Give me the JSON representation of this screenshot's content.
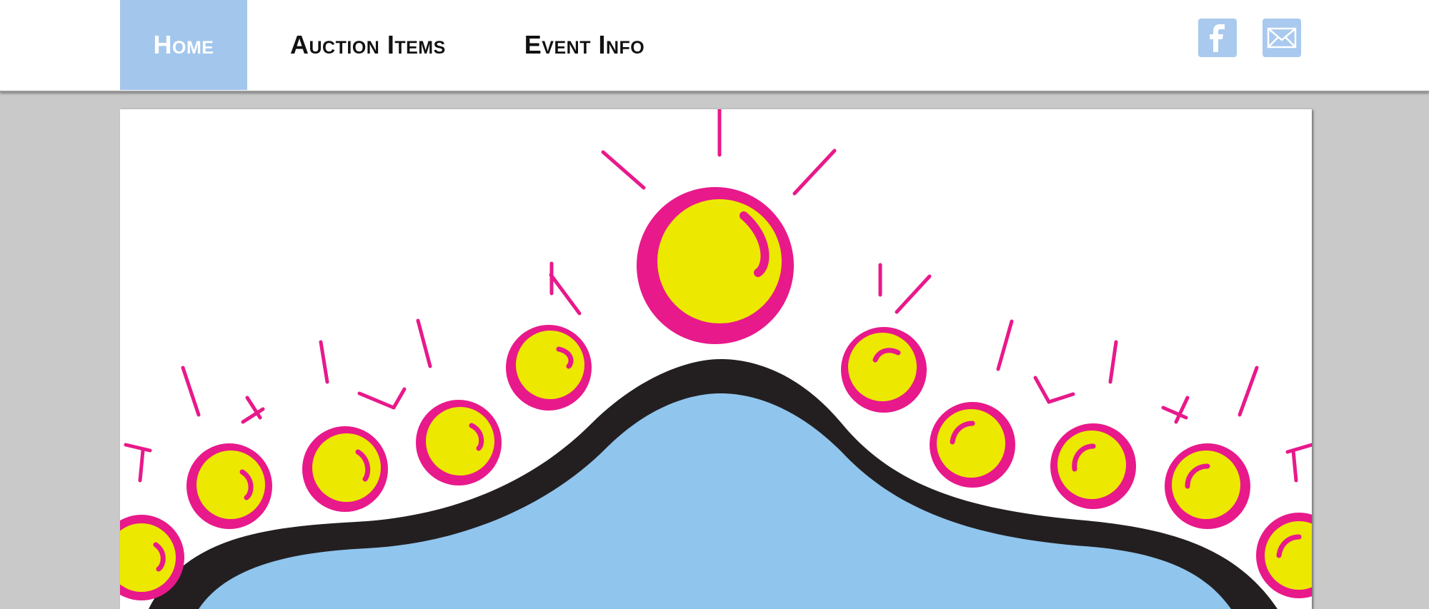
{
  "nav": {
    "items": [
      {
        "label": "Home",
        "active": true
      },
      {
        "label": "Auction Items",
        "active": false
      },
      {
        "label": "Event Info",
        "active": false
      }
    ]
  },
  "social": {
    "facebook": {
      "icon": "facebook-icon"
    },
    "email": {
      "icon": "mail-icon"
    }
  },
  "colors": {
    "nav_active_bg": "#a3c6ec",
    "page_bg": "#c9c9c9",
    "ball_fill": "#ece800",
    "ball_ring": "#e8198b",
    "hill_fill": "#90c5ee",
    "hill_outline": "#231f20"
  }
}
